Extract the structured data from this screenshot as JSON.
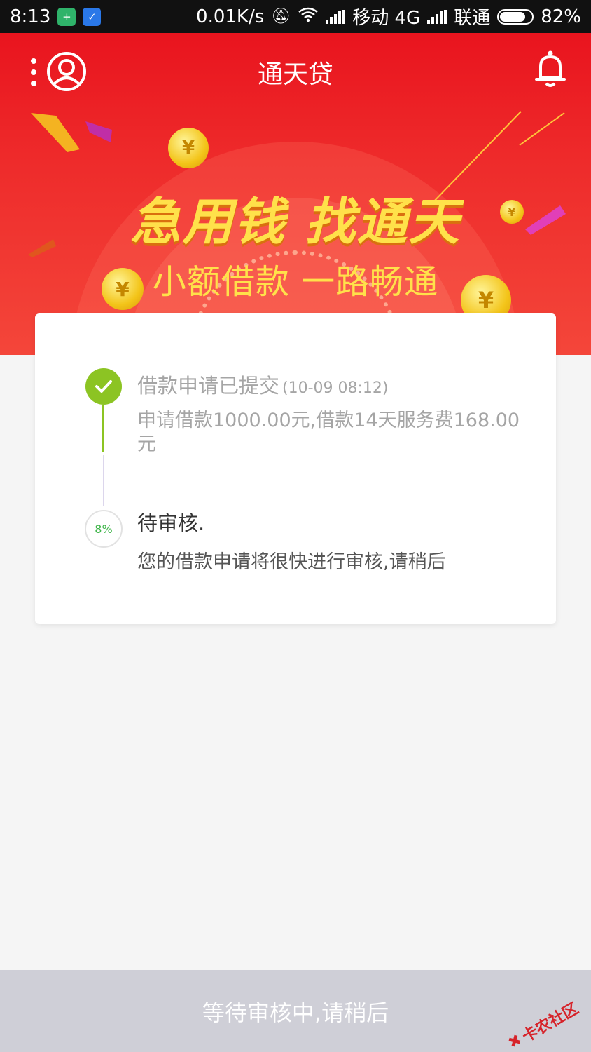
{
  "status_bar": {
    "time": "8:13",
    "network_speed": "0.01K/s",
    "carrier1": "移动 4G",
    "carrier2": "联通",
    "battery": "82%",
    "battery_level": 0.82
  },
  "header": {
    "title": "通天贷"
  },
  "banner": {
    "slogan_main": "急用钱 找通天",
    "slogan_sub": "小额借款 一路畅通"
  },
  "steps": [
    {
      "title": "借款申请已提交",
      "time": "(10-09 08:12)",
      "desc": "申请借款1000.00元,借款14天服务费168.00元",
      "status": "done"
    },
    {
      "title": "待审核.",
      "progress": "8%",
      "desc": "您的借款申请将很快进行审核,请稍后",
      "status": "pending"
    }
  ],
  "bottom": {
    "label": "等待审核中,请稍后"
  },
  "watermark": "卡农社区",
  "colors": {
    "header_red": "#e9141e",
    "done_green": "#8cc423",
    "slogan_yellow": "#ffe14a",
    "bottom_gray": "#cfcfd7"
  }
}
